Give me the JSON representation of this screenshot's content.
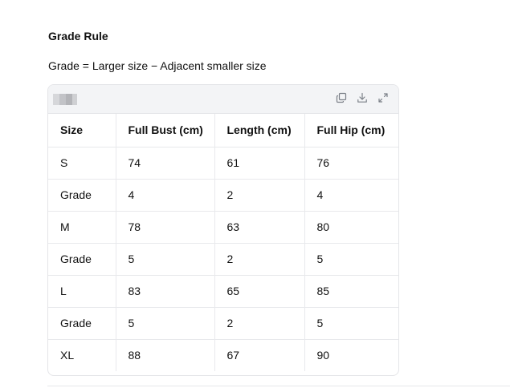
{
  "heading": "Grade Rule",
  "formula": "Grade = Larger size − Adjacent smaller size",
  "toolbar": {
    "icons": [
      "copy-icon",
      "download-icon",
      "expand-icon"
    ]
  },
  "table": {
    "headers": [
      "Size",
      "Full Bust (cm)",
      "Length (cm)",
      "Full Hip (cm)"
    ],
    "rows": [
      [
        "S",
        "74",
        "61",
        "76"
      ],
      [
        "Grade",
        "4",
        "2",
        "4"
      ],
      [
        "M",
        "78",
        "63",
        "80"
      ],
      [
        "Grade",
        "5",
        "2",
        "5"
      ],
      [
        "L",
        "83",
        "65",
        "85"
      ],
      [
        "Grade",
        "5",
        "2",
        "5"
      ],
      [
        "XL",
        "88",
        "67",
        "90"
      ]
    ]
  },
  "colors": {
    "toolbar_bg": "#f3f4f6",
    "border": "#e4e5e8",
    "text": "#111111",
    "icon": "#7a7f87"
  }
}
